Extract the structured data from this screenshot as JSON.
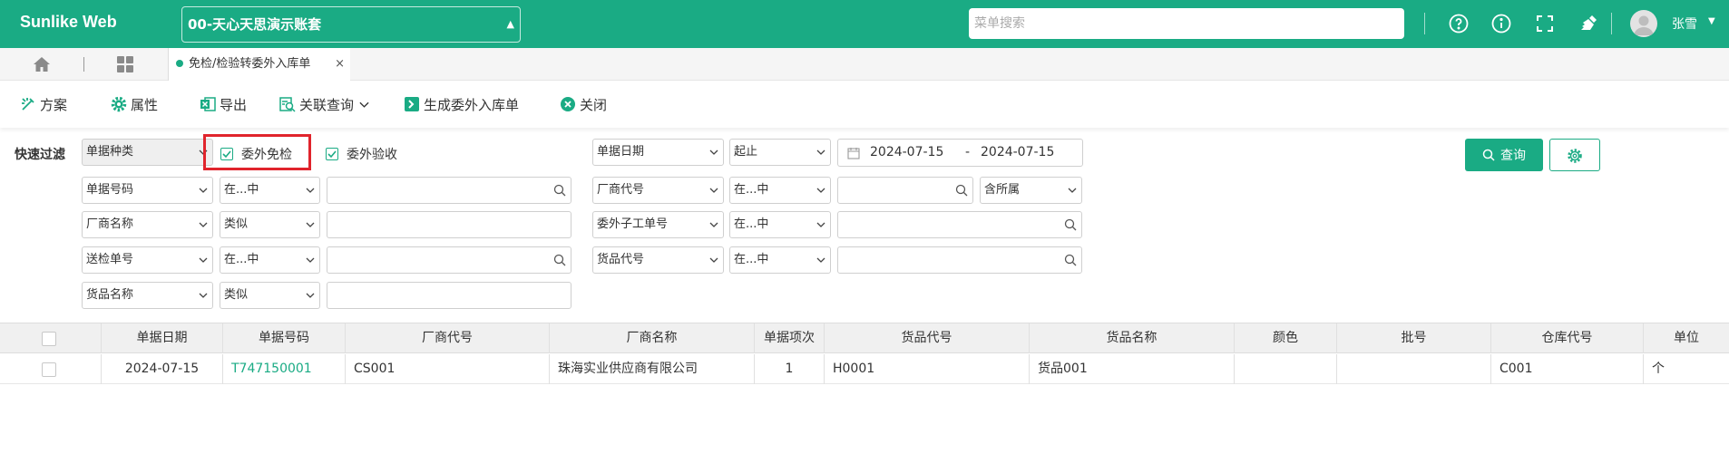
{
  "topbar": {
    "logo": "Sunlike Web",
    "account": "00-天心天思演示账套",
    "search_placeholder": "菜单搜索",
    "user": "张雪",
    "icons": [
      "help-icon",
      "info-icon",
      "fullscreen-icon",
      "clear-icon"
    ]
  },
  "tabbar": {
    "active_tab": "免检/检验转委外入库单",
    "close": "×"
  },
  "toolbar": {
    "plan": "方案",
    "props": "属性",
    "export": "导出",
    "related": "关联查询",
    "generate": "生成委外入库单",
    "close": "关闭"
  },
  "filter": {
    "label": "快速过滤",
    "doc_type": "单据种类",
    "cb_exempt": "委外免检",
    "cb_inspect": "委外验收",
    "date_field": "单据日期",
    "date_mode": "起止",
    "date_from": "2024-07-15",
    "date_sep": "-",
    "date_to": "2024-07-15",
    "query": "查询",
    "rows": [
      {
        "field": "单据号码",
        "op": "在...中"
      },
      {
        "field": "厂商名称",
        "op": "类似"
      },
      {
        "field": "送检单号",
        "op": "在...中"
      },
      {
        "field": "货品名称",
        "op": "类似"
      }
    ],
    "rows2": [
      {
        "field": "厂商代号",
        "op": "在...中"
      },
      {
        "field": "委外子工单号",
        "op": "在...中"
      },
      {
        "field": "货品代号",
        "op": "在...中"
      }
    ],
    "extra": "含所属"
  },
  "grid": {
    "headers": [
      "单据日期",
      "单据号码",
      "厂商代号",
      "厂商名称",
      "单据项次",
      "货品代号",
      "货品名称",
      "颜色",
      "批号",
      "仓库代号",
      "单位"
    ],
    "row": [
      "2024-07-15",
      "T747150001",
      "CS001",
      "珠海实业供应商有限公司",
      "1",
      "H0001",
      "货品001",
      "",
      "",
      "C001",
      "个"
    ]
  },
  "colors": {
    "accent": "#1aab84",
    "highlight": "#e0242c"
  }
}
